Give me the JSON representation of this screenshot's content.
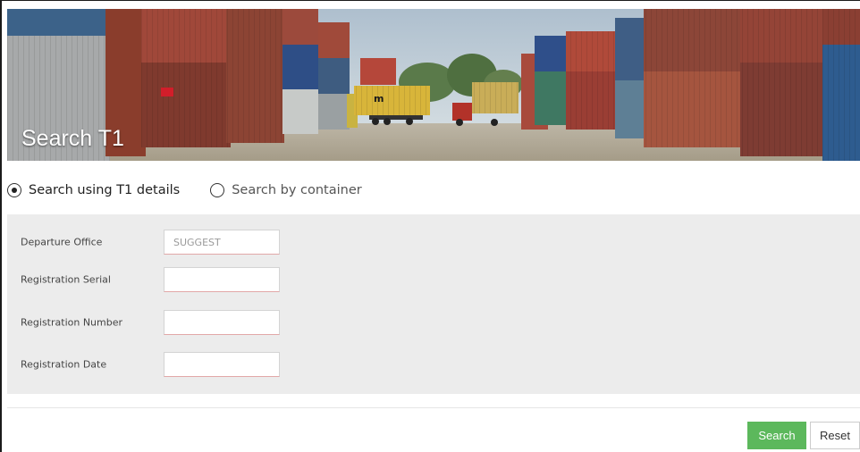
{
  "banner": {
    "title": "Search T1"
  },
  "search_mode": {
    "options": [
      {
        "label": "Search using T1 details",
        "selected": true
      },
      {
        "label": "Search by container",
        "selected": false
      }
    ]
  },
  "form": {
    "fields": [
      {
        "label": "Departure Office",
        "value": "",
        "placeholder": "SUGGEST"
      },
      {
        "label": "Registration Serial",
        "value": "",
        "placeholder": ""
      },
      {
        "label": "Registration Number",
        "value": "",
        "placeholder": ""
      },
      {
        "label": "Registration Date",
        "value": "",
        "placeholder": ""
      }
    ]
  },
  "actions": {
    "search_label": "Search",
    "reset_label": "Reset"
  },
  "colors": {
    "primary_button": "#5cb85c",
    "panel_background": "#ececec"
  }
}
